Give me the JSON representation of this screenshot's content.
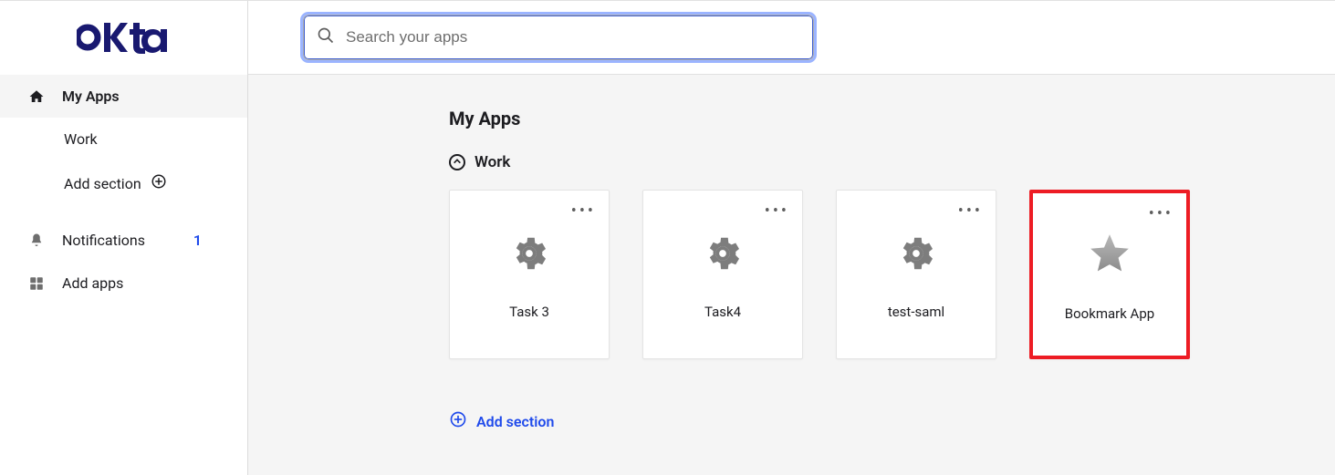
{
  "logo_text": "okta",
  "search": {
    "placeholder": "Search your apps"
  },
  "sidebar": {
    "my_apps": "My Apps",
    "work": "Work",
    "add_section": "Add section",
    "notifications": "Notifications",
    "notifications_count": "1",
    "add_apps": "Add apps"
  },
  "main": {
    "title": "My Apps",
    "section": "Work",
    "add_section": "Add section",
    "tiles": [
      {
        "label": "Task 3",
        "icon": "gear",
        "highlight": false
      },
      {
        "label": "Task4",
        "icon": "gear",
        "highlight": false
      },
      {
        "label": "test-saml",
        "icon": "gear",
        "highlight": false
      },
      {
        "label": "Bookmark App",
        "icon": "star",
        "highlight": true
      }
    ]
  }
}
